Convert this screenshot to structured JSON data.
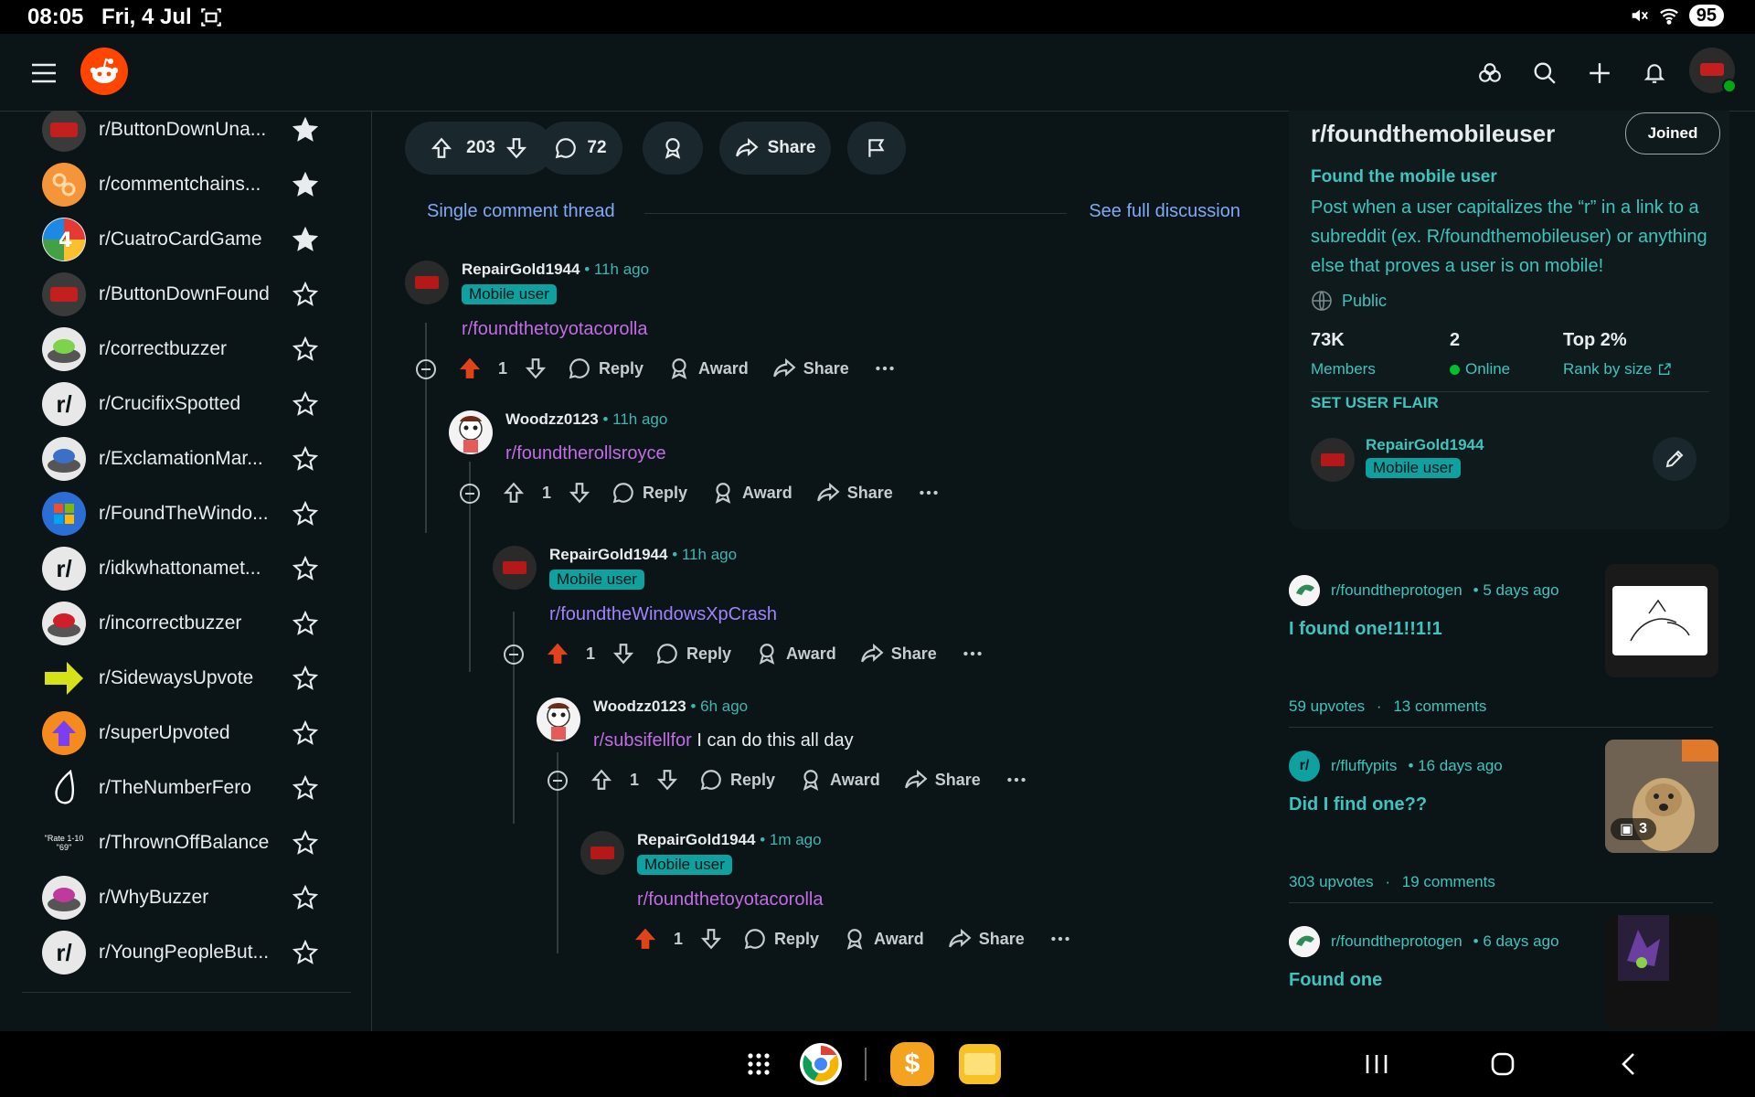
{
  "status_bar": {
    "time": "08:05",
    "date": "Fri, 4 Jul",
    "battery": "95"
  },
  "sidebar": {
    "communities": [
      {
        "name": "r/ButtonDownUna...",
        "favorite": true,
        "icon": "button-icon"
      },
      {
        "name": "r/commentchains...",
        "favorite": true,
        "icon": "chain-icon"
      },
      {
        "name": "r/CuatroCardGame",
        "favorite": true,
        "icon": "card-icon"
      },
      {
        "name": "r/ButtonDownFound",
        "favorite": false,
        "icon": "button-icon"
      },
      {
        "name": "r/correctbuzzer",
        "favorite": false,
        "icon": "buzzer-icon"
      },
      {
        "name": "r/CrucifixSpotted",
        "favorite": false,
        "icon": "r-slash-icon"
      },
      {
        "name": "r/ExclamationMar...",
        "favorite": false,
        "icon": "buzzer-icon"
      },
      {
        "name": "r/FoundTheWindo...",
        "favorite": false,
        "icon": "windows-icon"
      },
      {
        "name": "r/idkwhattonamet...",
        "favorite": false,
        "icon": "r-slash-icon"
      },
      {
        "name": "r/incorrectbuzzer",
        "favorite": false,
        "icon": "buzzer-icon"
      },
      {
        "name": "r/SidewaysUpvote",
        "favorite": false,
        "icon": "arrow-icon"
      },
      {
        "name": "r/superUpvoted",
        "favorite": false,
        "icon": "upvote-icon"
      },
      {
        "name": "r/TheNumberFero",
        "favorite": false,
        "icon": "drop-icon"
      },
      {
        "name": "r/ThrownOffBalance",
        "favorite": false,
        "icon": "text-icon"
      },
      {
        "name": "r/WhyBuzzer",
        "favorite": false,
        "icon": "buzzer-icon"
      },
      {
        "name": "r/YoungPeopleBut...",
        "favorite": false,
        "icon": "r-slash-icon"
      }
    ]
  },
  "post_actions": {
    "upvotes": "203",
    "comments": "72",
    "share": "Share"
  },
  "thread": {
    "single_label": "Single comment thread",
    "full_label": "See full discussion"
  },
  "comments": [
    {
      "author": "RepairGold1944",
      "ago": "• 11h ago",
      "flair": "Mobile user",
      "link": "r/foundthetoyotacorolla",
      "text": "",
      "votes": "1"
    },
    {
      "author": "Woodzz0123",
      "ago": "• 11h ago",
      "flair": "",
      "link": "r/foundtherollsroyce",
      "text": "",
      "votes": "1"
    },
    {
      "author": "RepairGold1944",
      "ago": "• 11h ago",
      "flair": "Mobile user",
      "link": "r/foundtheWindowsXpCrash",
      "text": "",
      "votes": "1"
    },
    {
      "author": "Woodzz0123",
      "ago": "• 6h ago",
      "flair": "",
      "link": "r/subsifellfor",
      "text": " I can do this all day",
      "votes": "1"
    },
    {
      "author": "RepairGold1944",
      "ago": "• 1m ago",
      "flair": "Mobile user",
      "link": "r/foundthetoyotacorolla",
      "text": "",
      "votes": "1"
    }
  ],
  "comment_actions": {
    "reply": "Reply",
    "award": "Award",
    "share": "Share"
  },
  "subreddit": {
    "name": "r/foundthemobileuser",
    "joined_label": "Joined",
    "title": "Found the mobile user",
    "description": "Post when a user capitalizes the “r” in a link to a subreddit (ex. R/foundthemobileuser) or anything else that proves a user is on mobile!",
    "visibility": "Public",
    "stats": [
      {
        "value": "73K",
        "label": "Members"
      },
      {
        "value": "2",
        "label": "Online"
      },
      {
        "value": "Top 2%",
        "label": "Rank by size"
      }
    ],
    "flair_heading": "SET USER FLAIR",
    "flair_user": "RepairGold1944",
    "flair_text": "Mobile user"
  },
  "related_posts": [
    {
      "subreddit": "r/foundtheprotogen",
      "ago": "• 5 days ago",
      "title": "I found one!1!!1!1",
      "upvotes": "59 upvotes",
      "sep": "·",
      "comments": "13 comments"
    },
    {
      "subreddit": "r/fluffypits",
      "ago": "• 16 days ago",
      "title": "Did I find one??",
      "upvotes": "303 upvotes",
      "sep": "·",
      "comments": "19 comments",
      "image_count": "3"
    },
    {
      "subreddit": "r/foundtheprotogen",
      "ago": "• 6 days ago",
      "title": "Found one",
      "upvotes": "",
      "sep": "",
      "comments": ""
    }
  ]
}
